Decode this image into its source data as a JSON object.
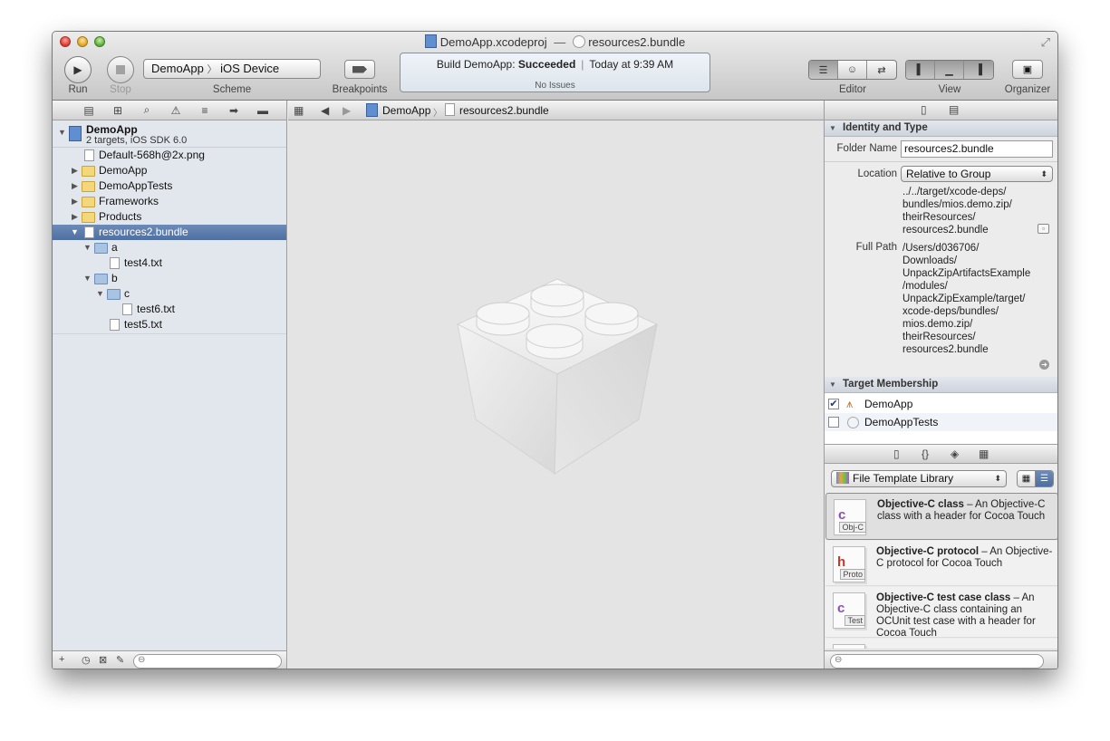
{
  "window": {
    "title_project": "DemoApp.xcodeproj",
    "title_sep": "—",
    "title_file": "resources2.bundle"
  },
  "toolbar": {
    "run_label": "Run",
    "stop_label": "Stop",
    "scheme_label": "Scheme",
    "scheme_target": "DemoApp",
    "scheme_sep": "〉",
    "scheme_device": "iOS Device",
    "breakpoints_label": "Breakpoints",
    "editor_label": "Editor",
    "view_label": "View",
    "organizer_label": "Organizer"
  },
  "activity": {
    "build_prefix": "Build DemoApp:",
    "build_status": "Succeeded",
    "time": "Today at 9:39 AM",
    "issues": "No Issues"
  },
  "navigator": {
    "project_name": "DemoApp",
    "project_sub": "2 targets, iOS SDK 6.0",
    "items": [
      {
        "label": "Default-568h@2x.png"
      },
      {
        "label": "DemoApp"
      },
      {
        "label": "DemoAppTests"
      },
      {
        "label": "Frameworks"
      },
      {
        "label": "Products"
      },
      {
        "label": "resources2.bundle"
      },
      {
        "label": "a"
      },
      {
        "label": "test4.txt"
      },
      {
        "label": "b"
      },
      {
        "label": "c"
      },
      {
        "label": "test6.txt"
      },
      {
        "label": "test5.txt"
      }
    ]
  },
  "jumpbar": {
    "crumb1": "DemoApp",
    "crumb_sep": "〉",
    "crumb2": "resources2.bundle"
  },
  "inspector": {
    "identity_header": "Identity and Type",
    "folder_name_label": "Folder Name",
    "folder_name_value": "resources2.bundle",
    "location_label": "Location",
    "location_value": "Relative to Group",
    "location_path": [
      "../../target/xcode-deps/",
      "bundles/mios.demo.zip/",
      "theirResources/",
      "resources2.bundle"
    ],
    "full_path_label": "Full Path",
    "full_path_lines": [
      "/Users/d036706/",
      "Downloads/",
      "UnpackZipArtifactsExample",
      "/modules/",
      "UnpackZipExample/target/",
      "xcode-deps/bundles/",
      "mios.demo.zip/",
      "theirResources/",
      "resources2.bundle"
    ],
    "membership_header": "Target Membership",
    "targets": [
      {
        "name": "DemoApp",
        "checked": true
      },
      {
        "name": "DemoAppTests",
        "checked": false
      }
    ]
  },
  "library": {
    "selector": "File Template Library",
    "items": [
      {
        "title": "Objective-C class",
        "desc": " – An Objective-C class with a header for Cocoa Touch",
        "badge": "Obj-C"
      },
      {
        "title": "Objective-C protocol",
        "desc": " – An Objective-C protocol for Cocoa Touch",
        "badge": "Proto"
      },
      {
        "title": "Objective-C test case class",
        "desc": " – An Objective-C class containing an OCUnit test case with a header for Cocoa Touch",
        "badge": "Test"
      }
    ]
  }
}
